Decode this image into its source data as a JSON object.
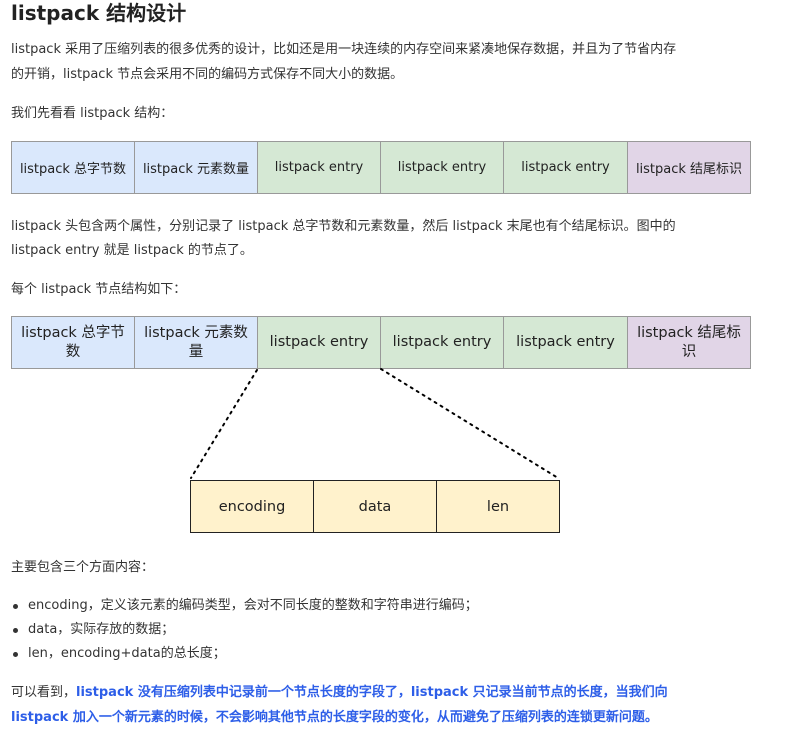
{
  "heading": "listpack 结构设计",
  "intro": [
    "listpack 采用了压缩列表的很多优秀的设计，比如还是用一块连续的内存空间来紧凑地保存数据，并且为了节省内存",
    "的开销，listpack 节点会采用不同的编码方式保存不同大小的数据。"
  ],
  "lead1": "我们先看看 listpack 结构：",
  "diagram1": [
    {
      "label": "listpack 总字节数",
      "color": "blue"
    },
    {
      "label": "listpack 元素数量",
      "color": "blue"
    },
    {
      "label": "listpack entry",
      "color": "green"
    },
    {
      "label": "listpack entry",
      "color": "green"
    },
    {
      "label": "listpack entry",
      "color": "green"
    },
    {
      "label": "listpack 结尾标识",
      "color": "purple"
    }
  ],
  "desc": [
    "listpack 头包含两个属性，分别记录了 listpack 总字节数和元素数量，然后 listpack 末尾也有个结尾标识。图中的",
    "listpack entry 就是 listpack 的节点了。"
  ],
  "lead2": "每个 listpack 节点结构如下：",
  "diagram2": [
    {
      "label": "listpack 总字节数",
      "color": "blue"
    },
    {
      "label": "listpack 元素数量",
      "color": "blue"
    },
    {
      "label": "listpack entry",
      "color": "green"
    },
    {
      "label": "listpack entry",
      "color": "green"
    },
    {
      "label": "listpack entry",
      "color": "green"
    },
    {
      "label": "listpack 结尾标识",
      "color": "purple"
    }
  ],
  "diagram3": [
    {
      "label": "encoding",
      "color": "yellow"
    },
    {
      "label": "data",
      "color": "yellow"
    },
    {
      "label": "len",
      "color": "yellow"
    }
  ],
  "lead3": "主要包含三个方面内容：",
  "bullets": [
    "encoding，定义该元素的编码类型，会对不同长度的整数和字符串进行编码；",
    "data，实际存放的数据；",
    "len，encoding+data的总长度；"
  ],
  "conclusion": {
    "line1_prefix": "可以看到，",
    "line1_strong": "listpack 没有压缩列表中记录前一个节点长度的字段了，listpack 只记录当前节点的长度，当我们向",
    "line2_strong": "listpack 加入一个新元素的时候，不会影响其他节点的长度字段的变化，从而避免了压缩列表的连锁更新问题。"
  },
  "colors": {
    "blue": "#dae8fc",
    "green": "#d5e8d4",
    "purple": "#e1d5e7",
    "yellow": "#fff2cc",
    "emphasis": "#2d5ee8"
  }
}
